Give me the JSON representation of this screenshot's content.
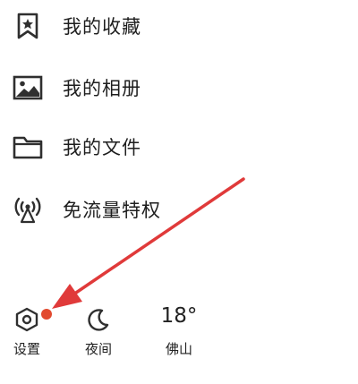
{
  "menu": {
    "items": [
      {
        "label": "我的收藏",
        "icon": "bookmark-star-icon"
      },
      {
        "label": "我的相册",
        "icon": "image-icon"
      },
      {
        "label": "我的文件",
        "icon": "folder-icon"
      },
      {
        "label": "免流量特权",
        "icon": "signal-tower-icon"
      }
    ]
  },
  "bottom_bar": {
    "settings": {
      "label": "设置",
      "icon": "settings-hexagon-icon"
    },
    "night": {
      "label": "夜间",
      "icon": "moon-icon"
    },
    "weather": {
      "temperature": "18°",
      "city": "佛山"
    }
  },
  "colors": {
    "icon": "#2f2f2f",
    "notify_dot": "#e24a2f",
    "arrow": "#e03a3a"
  }
}
